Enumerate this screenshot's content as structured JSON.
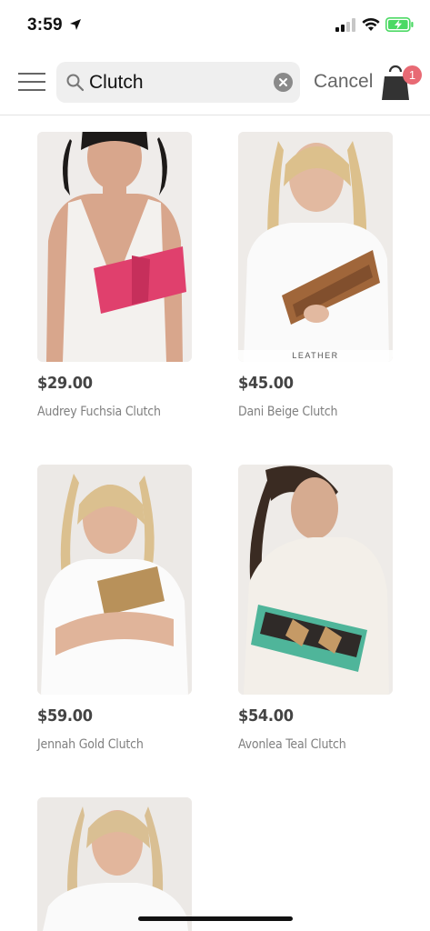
{
  "status_bar": {
    "time": "3:59"
  },
  "search": {
    "query": "Clutch",
    "cancel_label": "Cancel"
  },
  "cart": {
    "badge_count": "1"
  },
  "products": [
    {
      "price": "$29.00",
      "name": "Audrey Fuchsia Clutch",
      "clutch_color": "#e0406d",
      "tag": ""
    },
    {
      "price": "$45.00",
      "name": "Dani Beige Clutch",
      "clutch_color": "#a0663a",
      "tag": "LEATHER"
    },
    {
      "price": "$59.00",
      "name": "Jennah Gold Clutch",
      "clutch_color": "#b8915a",
      "tag": ""
    },
    {
      "price": "$54.00",
      "name": "Avonlea Teal Clutch",
      "clutch_color": "#4fb59a",
      "tag": ""
    },
    {
      "price": "",
      "name": "",
      "clutch_color": "",
      "tag": ""
    }
  ]
}
